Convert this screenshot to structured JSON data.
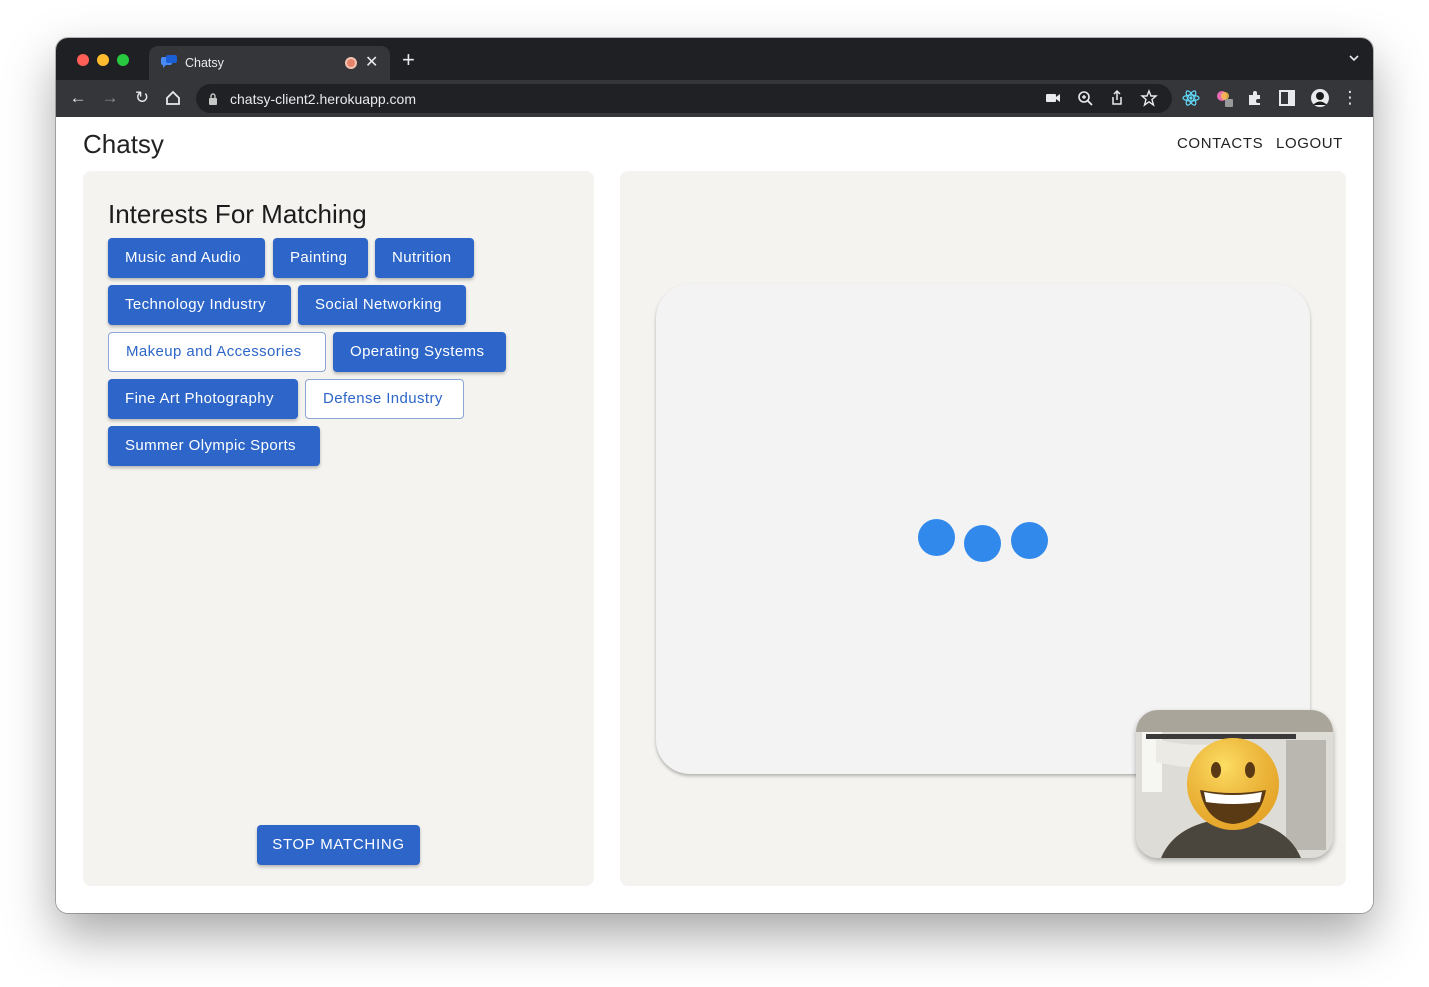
{
  "browser": {
    "tab": {
      "title": "Chatsy"
    },
    "url": "chatsy-client2.herokuapp.com"
  },
  "header": {
    "brand": "Chatsy",
    "nav": {
      "contacts": "CONTACTS",
      "logout": "LOGOUT"
    }
  },
  "interests": {
    "title": "Interests For Matching",
    "chips": [
      {
        "label": "Music and Audio",
        "selected": true
      },
      {
        "label": "Painting",
        "selected": true
      },
      {
        "label": "Nutrition",
        "selected": true
      },
      {
        "label": "Technology Industry",
        "selected": true
      },
      {
        "label": "Social Networking",
        "selected": true
      },
      {
        "label": "Makeup and Accessories",
        "selected": false
      },
      {
        "label": "Operating Systems",
        "selected": true
      },
      {
        "label": "Fine Art Photography",
        "selected": true
      },
      {
        "label": "Defense Industry",
        "selected": false
      },
      {
        "label": "Summer Olympic Sports",
        "selected": true
      }
    ],
    "stop_label": "STOP MATCHING"
  },
  "colors": {
    "primary": "#2d66c8",
    "loader": "#3289ec",
    "panel_bg": "#f4f3ef"
  }
}
